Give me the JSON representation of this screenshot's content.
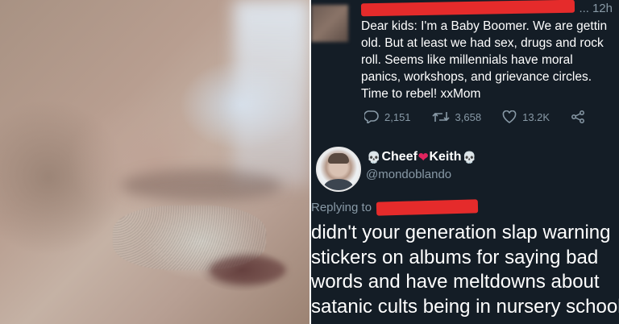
{
  "photo": {
    "description_icon": "blurred-face-photo"
  },
  "original_tweet": {
    "timestamp": "12h",
    "ellipsis": "...",
    "lines": [
      "Dear kids: I'm a Baby Boomer. We are gettin",
      "old. But at least we had sex, drugs and rock",
      "roll. Seems like millennials have moral",
      "panics, workshops, and grievance circles.",
      "Time to rebel! xxMom"
    ],
    "replies_count": "2,151",
    "retweets_count": "3,658",
    "likes_count": "13.2K"
  },
  "reply": {
    "display_name_part1": "Cheef",
    "display_name_part2": "Keith",
    "handle": "@mondoblando",
    "replying_to_label": "Replying to",
    "lines": [
      "didn't your generation slap warning",
      "stickers on albums for saying bad",
      "words and have meltdowns about",
      "satanic cults being in nursery school"
    ]
  },
  "colors": {
    "background": "#141d26",
    "secondary_text": "#8899a6",
    "redaction": "#e52b2b",
    "heart": "#e0245e"
  }
}
